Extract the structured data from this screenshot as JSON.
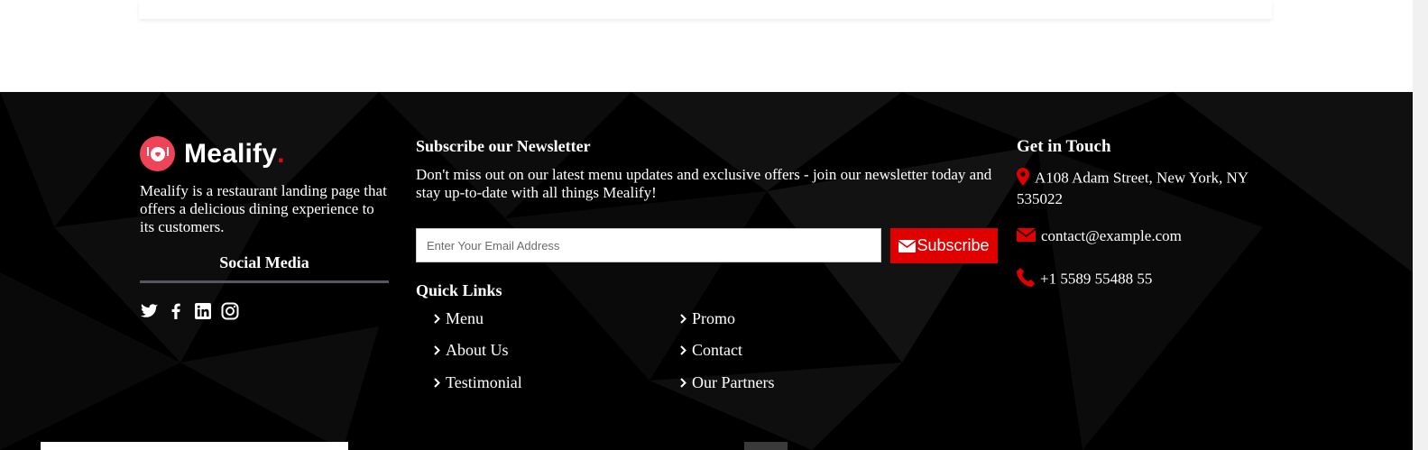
{
  "brand": {
    "name": "Mealify",
    "dot": ".",
    "description": "Mealify is a restaurant landing page that offers a delicious dining experience to its customers.",
    "accent_color": "#e30613",
    "logo_color": "#ef4458"
  },
  "social": {
    "title": "Social Media",
    "icons": [
      "twitter-icon",
      "facebook-icon",
      "linkedin-icon",
      "instagram-icon"
    ]
  },
  "newsletter": {
    "title": "Subscribe our Newsletter",
    "text": "Don't miss out on our latest menu updates and exclusive offers - join our newsletter today and stay up-to-date with all things Mealify!",
    "placeholder": "Enter Your Email Address",
    "button_label": "Subscribe",
    "button_color": "#e00000"
  },
  "quick_links": {
    "title": "Quick Links",
    "items": [
      "Menu",
      "About Us",
      "Testimonial",
      "Promo",
      "Contact",
      "Our Partners"
    ]
  },
  "contact": {
    "title": "Get in Touch",
    "address": "A108 Adam Street, New York, NY 535022",
    "email": "contact@example.com",
    "phone": "+1 5589 55488 55"
  }
}
